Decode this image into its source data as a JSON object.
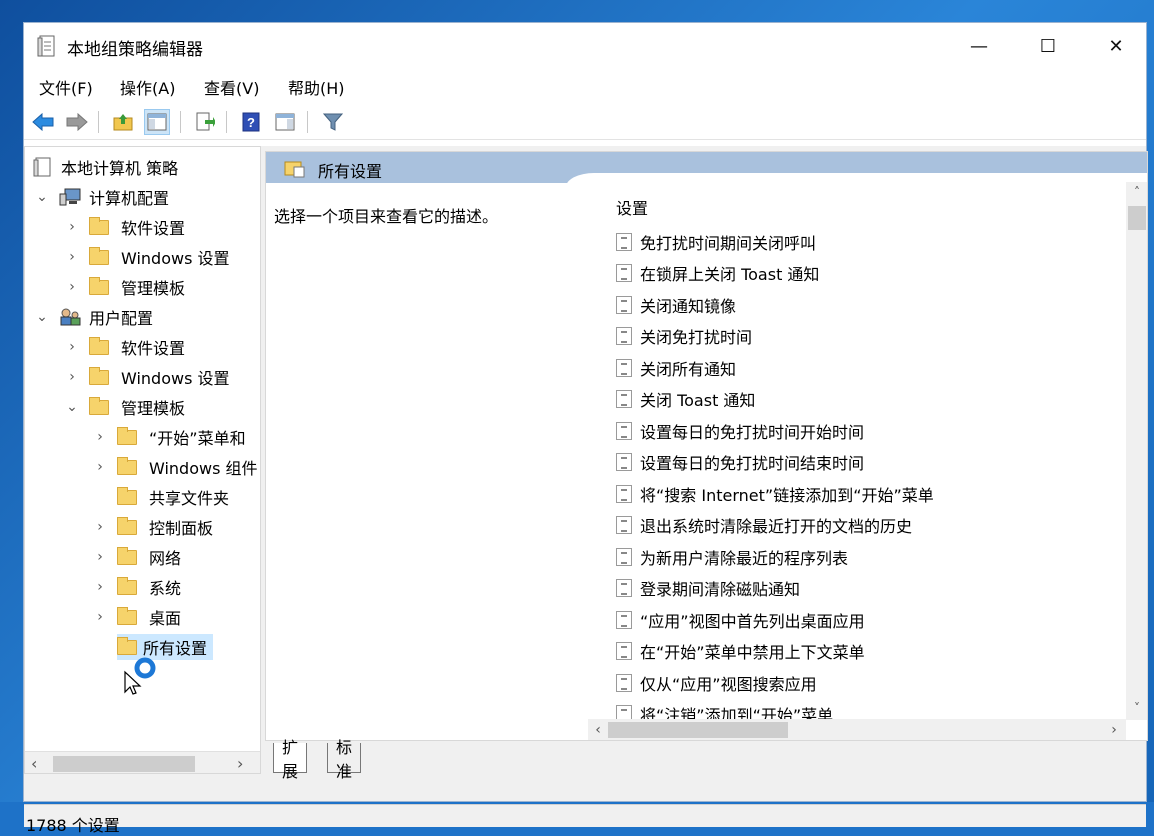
{
  "window": {
    "title": "本地组策略编辑器",
    "controls": {
      "minimize": "—",
      "maximize": "☐",
      "close": "✕"
    }
  },
  "menu": {
    "items": [
      "文件(F)",
      "操作(A)",
      "查看(V)",
      "帮助(H)"
    ]
  },
  "toolbar": {
    "icons": [
      "back-arrow-icon",
      "forward-arrow-icon",
      "up-folder-icon",
      "show-hide-tree-icon",
      "export-list-icon",
      "help-icon",
      "properties-pane-icon",
      "filter-icon"
    ]
  },
  "tree": {
    "items": [
      {
        "label": "本地计算机 策略"
      },
      {
        "label": "计算机配置",
        "expander": "⌄"
      },
      {
        "label": "软件设置",
        "expander": "›"
      },
      {
        "label": "Windows 设置",
        "expander": "›"
      },
      {
        "label": "管理模板",
        "expander": "›"
      },
      {
        "label": "用户配置",
        "expander": "⌄"
      },
      {
        "label": "软件设置",
        "expander": "›"
      },
      {
        "label": "Windows 设置",
        "expander": "›"
      },
      {
        "label": "管理模板",
        "expander": "⌄"
      },
      {
        "label": "“开始”菜单和",
        "expander": "›"
      },
      {
        "label": "Windows 组件",
        "expander": "›"
      },
      {
        "label": "共享文件夹",
        "expander": ""
      },
      {
        "label": "控制面板",
        "expander": "›"
      },
      {
        "label": "网络",
        "expander": "›"
      },
      {
        "label": "系统",
        "expander": "›"
      },
      {
        "label": "桌面",
        "expander": "›"
      },
      {
        "label": "所有设置",
        "expander": ""
      }
    ],
    "scroll_left": "‹",
    "scroll_right": "›"
  },
  "details": {
    "header_title": "所有设置",
    "description": "选择一个项目来查看它的描述。",
    "column_header": "设置",
    "settings": [
      "免打扰时间期间关闭呼叫",
      "在锁屏上关闭 Toast 通知",
      "关闭通知镜像",
      "关闭免打扰时间",
      "关闭所有通知",
      "关闭 Toast 通知",
      "设置每日的免打扰时间开始时间",
      "设置每日的免打扰时间结束时间",
      "将“搜索 Internet”链接添加到“开始”菜单",
      "退出系统时清除最近打开的文档的历史",
      "为新用户清除最近的程序列表",
      "登录期间清除磁贴通知",
      "“应用”视图中首先列出桌面应用",
      "在“开始”菜单中禁用上下文菜单",
      "仅从“应用”视图搜索应用",
      "将“注销”添加到“开始”菜单"
    ],
    "vscroll_up": "˄",
    "vscroll_down": "˅",
    "hscroll_left": "‹",
    "hscroll_right": "›"
  },
  "tabs": [
    "扩展",
    "标准"
  ],
  "status": {
    "text": "1788 个设置"
  }
}
